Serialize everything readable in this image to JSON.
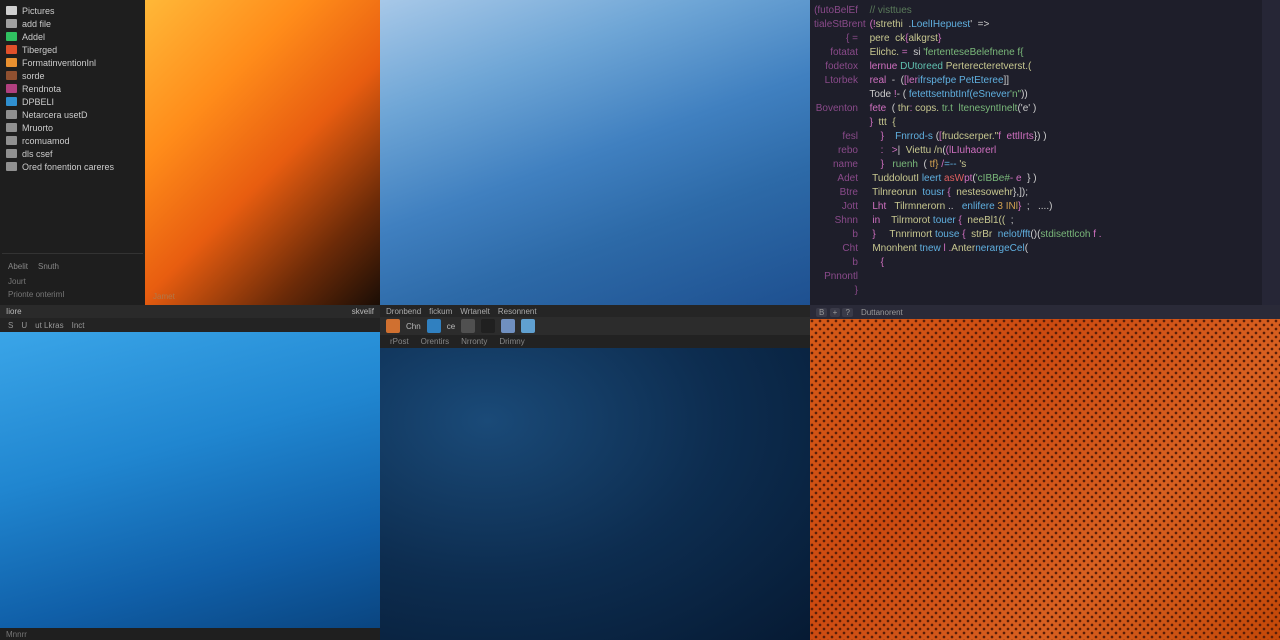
{
  "sidebar": {
    "items": [
      {
        "label": "Pictures",
        "color": "#d0d0d0"
      },
      {
        "label": "add file",
        "color": "#a0a0a0"
      },
      {
        "label": "Addel",
        "color": "#30c060"
      },
      {
        "label": "Tiberged",
        "color": "#e0502a"
      },
      {
        "label": "FormatinventionInl",
        "color": "#e89030"
      },
      {
        "label": "sorde",
        "color": "#905030"
      },
      {
        "label": "Rendnota",
        "color": "#b04080"
      },
      {
        "label": "DPBELI",
        "color": "#3090d0"
      },
      {
        "label": "Netarcera usetD",
        "color": "#909090"
      },
      {
        "label": "Mruorto",
        "color": "#909090"
      },
      {
        "label": "rcomuamod",
        "color": "#909090"
      },
      {
        "label": "dls csef",
        "color": "#909090"
      },
      {
        "label": "Ored fonention careres",
        "color": "#909090"
      }
    ],
    "footer_a": "Abelit",
    "footer_b": "Snuth",
    "footer_c": "Jourt",
    "footer_d": "Prionte onterimI"
  },
  "gradient_label": "Jamet",
  "editor": {
    "gutter": "(futoBelEf\ntialeStBrent\n{ =\nfotatat\nfodetox\nLtorbek\n\nBoventon\n\n  fesl\n  rebo\n  name\n  Adet\n  Btre\n  Jott\n  Shnn\n  b\n  Cht\n  b\nPnnontl\n}",
    "lines": [
      {
        "pre": "  ",
        "tokens": [
          [
            "cm",
            "// visttues"
          ]
        ]
      },
      {
        "pre": "",
        "tokens": []
      },
      {
        "pre": "  ",
        "tokens": [
          [
            "kw",
            "(!"
          ],
          [
            "id",
            "strethi"
          ],
          [
            "",
            "  ."
          ],
          [
            "fn",
            "LoelIHepuest"
          ],
          [
            "",
            "'  =>"
          ]
        ]
      },
      {
        "pre": "  ",
        "tokens": [
          [
            "id",
            "pere  ck"
          ],
          [
            "kw",
            "{"
          ],
          [
            "id",
            "alkgrst"
          ],
          [
            "kw",
            "}"
          ]
        ]
      },
      {
        "pre": "  ",
        "tokens": [
          [
            "id",
            "Elichc. "
          ],
          [
            "kw",
            "="
          ],
          [
            "",
            "  si "
          ],
          [
            "str",
            "'fertenteseBelefnene f{"
          ]
        ]
      },
      {
        "pre": "  ",
        "tokens": [
          [
            "kw",
            "lernue "
          ],
          [
            "ty",
            "DUtoreed"
          ],
          [
            "id",
            " Perterecteretverst.("
          ]
        ]
      },
      {
        "pre": "  ",
        "tokens": [
          [
            "kw",
            "real  "
          ],
          [
            "",
            "-  ("
          ],
          [
            "kw",
            "[ler"
          ],
          [
            "fn",
            "ifrspefpe PetEteree"
          ],
          [
            "",
            "]]"
          ]
        ]
      },
      {
        "pre": "  ",
        "tokens": [
          [
            "",
            "Tode "
          ],
          [
            "kw",
            "!"
          ],
          [
            "",
            "- ( "
          ],
          [
            "fn",
            "fetettsetnbtInf(eSnever"
          ],
          [
            "str",
            "'n\""
          ],
          [
            "",
            "))"
          ]
        ]
      },
      {
        "pre": "  ",
        "tokens": [
          [
            "kw",
            "fete"
          ],
          [
            "",
            "  ( "
          ],
          [
            "id",
            "thr"
          ],
          [
            "kw",
            ":"
          ],
          [
            "id",
            " cops. "
          ],
          [
            "str",
            "tr.t  ltenesyntInelt"
          ],
          [
            "",
            "('e' )"
          ]
        ]
      },
      {
        "pre": "  ",
        "tokens": [
          [
            "kw",
            "}"
          ],
          [
            "id",
            "  ttt  {"
          ]
        ]
      },
      {
        "pre": "      ",
        "tokens": [
          [
            "kw",
            "}"
          ],
          [
            "",
            "    "
          ],
          [
            "fn",
            "Fnrrod-s "
          ],
          [
            "",
            "("
          ],
          [
            "kw",
            "["
          ],
          [
            "id",
            "frudcserper.\""
          ],
          [
            "kw",
            "f  ettlIrts"
          ],
          [
            "",
            "}"
          ],
          [
            "",
            ") )"
          ]
        ]
      },
      {
        "pre": "      ",
        "tokens": [
          [
            "kw",
            ":"
          ],
          [
            "",
            "   "
          ],
          [
            "kw",
            ">"
          ],
          [
            "",
            "|  "
          ],
          [
            "id",
            "Viettu /n"
          ],
          [
            "",
            "("
          ],
          [
            "kw",
            "(lLIuhaorerl"
          ]
        ]
      },
      {
        "pre": "      ",
        "tokens": [
          [
            "kw",
            "}"
          ],
          [
            "",
            "   "
          ],
          [
            "str",
            "ruenh  "
          ],
          [
            "",
            "( "
          ],
          [
            "num",
            "tf}"
          ],
          [
            "kw",
            " /"
          ],
          [
            "fn",
            "=-- "
          ],
          [
            "id",
            "'s"
          ]
        ]
      },
      {
        "pre": "   ",
        "tokens": [
          [
            "id",
            "TuddoloutI "
          ],
          [
            "fn",
            "leert"
          ],
          [
            "err",
            " asW"
          ],
          [
            "kw",
            "pt"
          ],
          [
            "",
            "("
          ],
          [
            "str",
            "'cIBBe#"
          ],
          [
            "kw",
            "- e"
          ],
          [
            "",
            "  } )"
          ]
        ]
      },
      {
        "pre": "   ",
        "tokens": [
          [
            "id",
            "Tilnreorun  "
          ],
          [
            "fn",
            "tousr"
          ],
          [
            "kw",
            " {  "
          ],
          [
            "id",
            "nestesowehr"
          ],
          [
            "",
            "},]);"
          ]
        ]
      },
      {
        "pre": "   ",
        "tokens": [
          [
            "kw",
            "Lht   "
          ],
          [
            "id",
            "Tilrmnerorn "
          ],
          [
            "",
            "..   "
          ],
          [
            "fn",
            "enlifere "
          ],
          [
            "num",
            "3 INl"
          ],
          [
            "kw",
            "}"
          ],
          [
            "",
            "  ;   ....)"
          ]
        ]
      },
      {
        "pre": "   ",
        "tokens": [
          [
            "kw",
            "in    "
          ],
          [
            "id",
            "Tilrmorot "
          ],
          [
            "fn",
            "touer"
          ],
          [
            "kw",
            " {  "
          ],
          [
            "id",
            "neeBl1(("
          ],
          [
            "",
            "  ;"
          ]
        ]
      },
      {
        "pre": "   ",
        "tokens": [
          [
            "kw",
            "}     "
          ],
          [
            "id",
            "Tnnrimort "
          ],
          [
            "fn",
            "touse"
          ],
          [
            "kw",
            " {  "
          ],
          [
            "id",
            "strBr  "
          ],
          [
            "fn",
            "nelot/fft"
          ],
          [
            "",
            "()("
          ],
          [
            "str",
            "stdisettlcoh"
          ],
          [
            "kw",
            " f ."
          ]
        ]
      },
      {
        "pre": "   ",
        "tokens": [
          [
            "id",
            "Mnonhent "
          ],
          [
            "fn",
            "tnew"
          ],
          [
            "kw",
            " l "
          ],
          [
            "kw",
            "."
          ],
          [
            "id",
            "Anter"
          ],
          [
            "fn",
            "nerargeCel"
          ],
          [
            "",
            "("
          ]
        ]
      },
      {
        "pre": "      ",
        "tokens": [
          [
            "kw",
            "{"
          ]
        ]
      }
    ]
  },
  "panel4": {
    "title_l": "Iiore",
    "title_r": "skvelif",
    "menu": [
      "S",
      "U",
      "ut Lkras",
      "Inct"
    ],
    "status": "Mnnrr"
  },
  "panel5": {
    "title": [
      "Dronbend",
      "fickum",
      "Wrtanelt",
      "Resonnent"
    ],
    "tool_labels": [
      "Chn",
      "ce"
    ],
    "tool_icons": [
      "#d07030",
      "#3080c0",
      "#505050",
      "#202020",
      "#7090c0",
      "#60a0d0"
    ],
    "menu2": [
      "rPost",
      "Orentirs",
      "Nrronty",
      "Drimny"
    ]
  },
  "panel6": {
    "btns": [
      "B",
      "+",
      "?"
    ],
    "label": "Duttanorent"
  }
}
